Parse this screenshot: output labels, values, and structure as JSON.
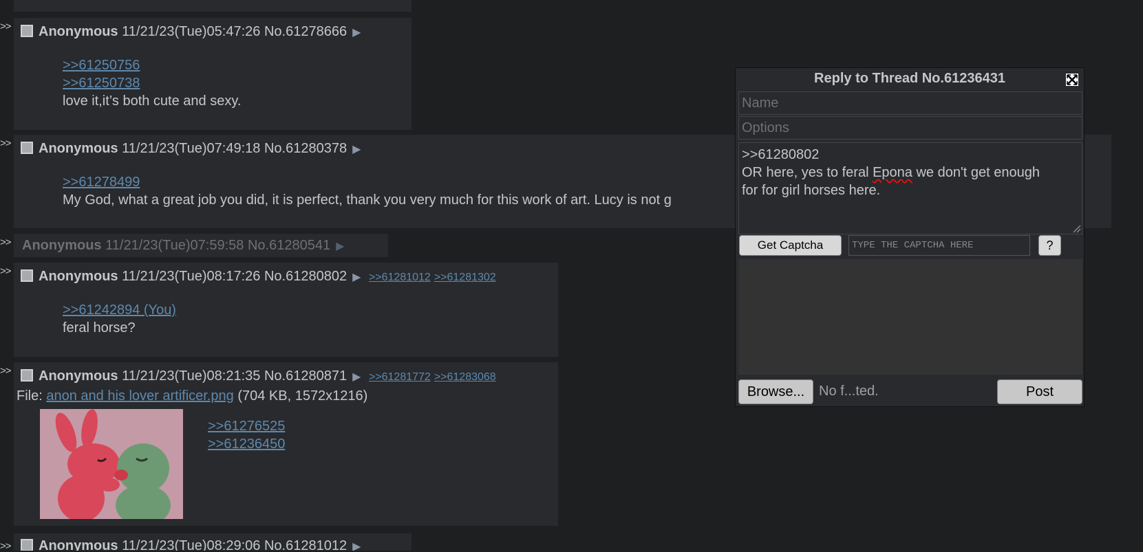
{
  "posts": [
    {
      "name": "Anonymous",
      "datetime": "11/21/23(Tue)05:47:26",
      "postno": "No.61278666",
      "quotes": [
        ">>61250756",
        ">>61250738"
      ],
      "text": "love it,it’s both cute and sexy."
    },
    {
      "name": "Anonymous",
      "datetime": "11/21/23(Tue)07:49:18",
      "postno": "No.61280378",
      "quotes": [
        ">>61278499"
      ],
      "text": "My God, what a great job you did, it is perfect, thank you very much for this work of art. Lucy is not g"
    },
    {
      "name": "Anonymous",
      "datetime": "11/21/23(Tue)07:59:58",
      "postno": "No.61280541"
    },
    {
      "name": "Anonymous",
      "datetime": "11/21/23(Tue)08:17:26",
      "postno": "No.61280802",
      "backlinks": [
        ">>61281012",
        ">>61281302"
      ],
      "quotes": [
        ">>61242894 (You)"
      ],
      "text": "feral horse?"
    },
    {
      "name": "Anonymous",
      "datetime": "11/21/23(Tue)08:21:35",
      "postno": "No.61280871",
      "backlinks": [
        ">>61281772",
        ">>61283068"
      ],
      "file_label": "File: ",
      "file_name": "anon and his lover artificer.png",
      "file_meta": "(704 KB, 1572x1216)",
      "quotes": [
        ">>61276525",
        ">>61236450"
      ]
    },
    {
      "name": "Anonymous",
      "datetime": "11/21/23(Tue)08:29:06",
      "postno": "No.61281012"
    }
  ],
  "reply_window": {
    "title": "Reply to Thread No.61236431",
    "name_placeholder": "Name",
    "options_placeholder": "Options",
    "comment_lines": [
      ">>61280802",
      "OR here, yes to feral ",
      "Epona",
      " we don't get enough",
      "for for girl horses here."
    ],
    "captcha_button": "Get Captcha",
    "captcha_placeholder": "TYPE THE CAPTCHA HERE",
    "captcha_help": "?",
    "browse_label": "Browse...",
    "file_status": "No f...ted.",
    "post_label": "Post"
  },
  "colors": {
    "background": "#1d1f21",
    "post_bg": "#282a2e",
    "link": "#5f89ac",
    "text": "#c5c8c6"
  }
}
